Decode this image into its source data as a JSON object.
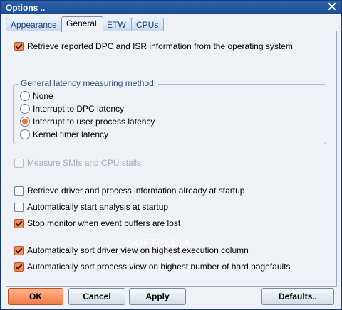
{
  "window": {
    "title": "Options .."
  },
  "tabs": [
    {
      "label": "Appearance"
    },
    {
      "label": "General"
    },
    {
      "label": "ETW"
    },
    {
      "label": "CPUs"
    }
  ],
  "general": {
    "retrieve_dpc": {
      "label": "Retrieve reported DPC and ISR information from the operating system",
      "checked": true
    },
    "method_group": {
      "legend": "General latency measuring method:",
      "options": [
        {
          "label": "None",
          "selected": false
        },
        {
          "label": "Interrupt to DPC latency",
          "selected": false
        },
        {
          "label": "Interrupt to user process latency",
          "selected": true
        },
        {
          "label": "Kernel timer latency",
          "selected": false
        }
      ]
    },
    "measure_smis": {
      "label": "Measure SMIs and CPU stalls",
      "checked": false,
      "enabled": false
    },
    "retrieve_driver_info": {
      "label": "Retrieve driver and process information already at startup",
      "checked": false
    },
    "auto_start": {
      "label": "Automatically start analysis at startup",
      "checked": false
    },
    "stop_monitor": {
      "label": "Stop monitor when event buffers are lost",
      "checked": true
    },
    "sort_driver": {
      "label": "Automatically sort driver view on highest execution column",
      "checked": true
    },
    "sort_process": {
      "label": "Automatically sort process view on highest number of hard pagefaults",
      "checked": true
    }
  },
  "buttons": {
    "ok": "OK",
    "cancel": "Cancel",
    "apply": "Apply",
    "defaults": "Defaults.."
  },
  "watermark": "SOFTPEDIA"
}
